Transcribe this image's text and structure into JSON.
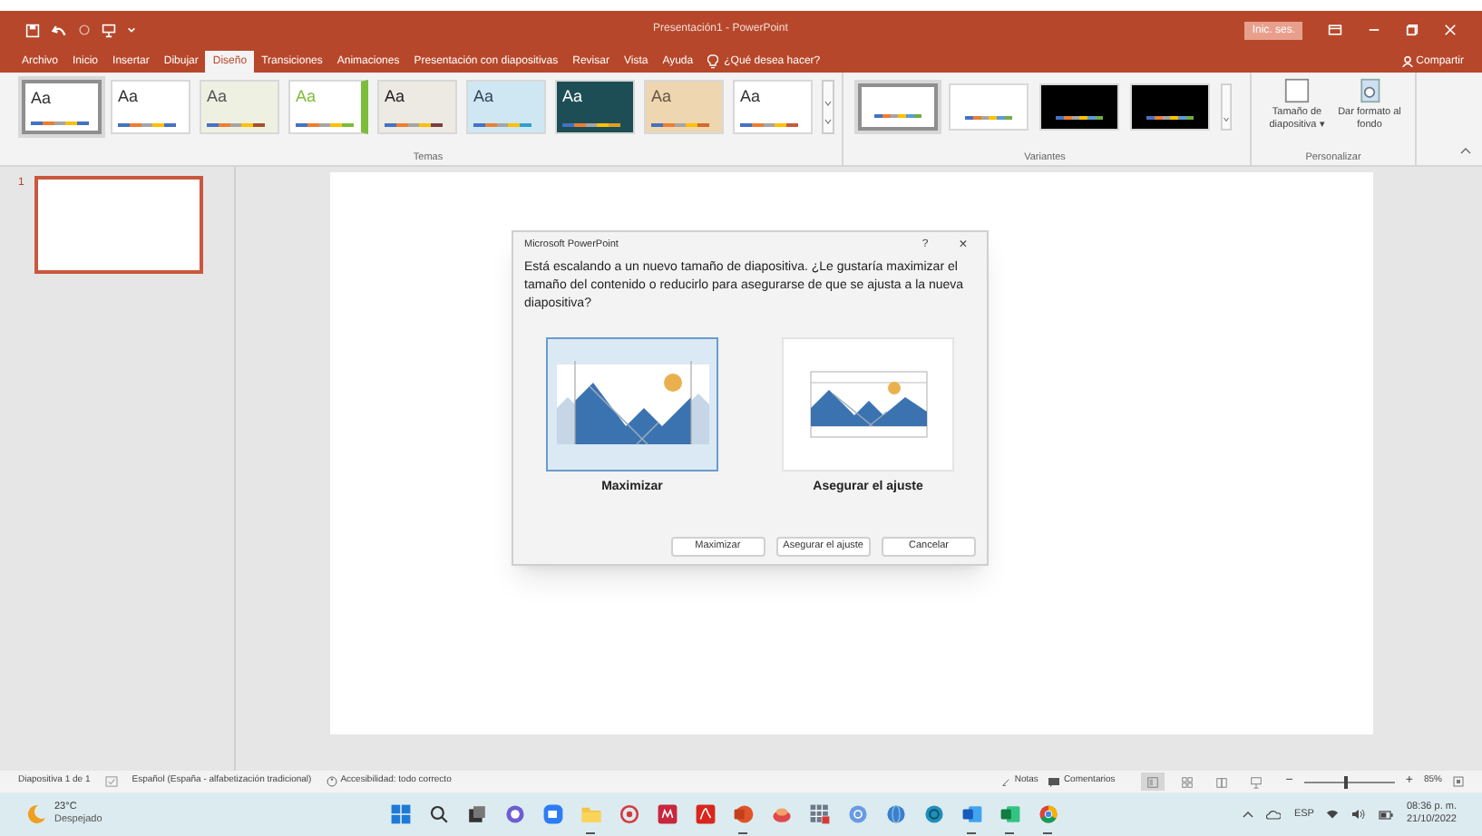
{
  "window": {
    "title": "Presentación1 - PowerPoint",
    "sign_in": "Inic. ses."
  },
  "ribbon_tabs": [
    {
      "label": "Archivo",
      "selected": false
    },
    {
      "label": "Inicio",
      "selected": false
    },
    {
      "label": "Insertar",
      "selected": false
    },
    {
      "label": "Dibujar",
      "selected": false
    },
    {
      "label": "Diseño",
      "selected": true
    },
    {
      "label": "Transiciones",
      "selected": false
    },
    {
      "label": "Animaciones",
      "selected": false
    },
    {
      "label": "Presentación con diapositivas",
      "selected": false
    },
    {
      "label": "Revisar",
      "selected": false
    },
    {
      "label": "Vista",
      "selected": false
    },
    {
      "label": "Ayuda",
      "selected": false
    }
  ],
  "tell_me": "¿Qué desea hacer?",
  "share": "Compartir",
  "themes": {
    "label": "Temas",
    "items": [
      {
        "label": "Aa",
        "selected": true
      },
      {
        "label": "Aa",
        "selected": false
      },
      {
        "label": "Aa",
        "selected": false
      },
      {
        "label": "Aa",
        "selected": false
      },
      {
        "label": "Aa",
        "selected": false
      },
      {
        "label": "Aa",
        "selected": false
      },
      {
        "label": "Aa",
        "selected": false
      },
      {
        "label": "Aa",
        "selected": false
      },
      {
        "label": "Aa",
        "selected": false
      }
    ]
  },
  "variants": {
    "label": "Variantes",
    "items": [
      {
        "selected": true
      },
      {
        "selected": false
      },
      {
        "selected": false
      },
      {
        "selected": false
      }
    ]
  },
  "customize": {
    "label": "Personalizar",
    "buttons": [
      {
        "kind": "size",
        "label": "Tamaño de diapositiva",
        "caret": "▾"
      },
      {
        "kind": "background",
        "label": "Dar formato al fondo"
      }
    ]
  },
  "slides": [
    {
      "number": "1",
      "selected": true
    }
  ],
  "dialog": {
    "title": "Microsoft PowerPoint",
    "help": "?",
    "close": "×",
    "message": "Está escalando a un nuevo tamaño de diapositiva. ¿Le gustaría maximizar el tamaño del contenido o reducirlo para asegurarse de que se ajusta a la nueva diapositiva?",
    "options": [
      {
        "kind": "maximize",
        "label": "Maximizar",
        "selected": true
      },
      {
        "kind": "fit",
        "label": "Asegurar el ajuste",
        "selected": false
      }
    ],
    "buttons": [
      "Maximizar",
      "Asegurar el ajuste",
      "Cancelar"
    ]
  },
  "status_bar": {
    "slide": "Diapositiva 1 de 1",
    "language": "Español (España - alfabetización tradicional)",
    "accessibility": "Accesibilidad: todo correcto",
    "notes": "Notas",
    "comments": "Comentarios",
    "views": [
      {
        "kind": "normal",
        "selected": true
      },
      {
        "kind": "sorter",
        "selected": false
      },
      {
        "kind": "reading",
        "selected": false
      },
      {
        "kind": "show",
        "selected": false
      }
    ],
    "zoom_out": "−",
    "zoom_slider": {
      "level": 0.45
    },
    "zoom_in": "+",
    "zoom": "85%"
  },
  "taskbar": {
    "temperature": "23°C",
    "weather": "Despejado",
    "apps": [
      {
        "kind": "start",
        "running": false
      },
      {
        "kind": "search",
        "running": false
      },
      {
        "kind": "taskview",
        "running": false
      },
      {
        "kind": "chat",
        "running": false
      },
      {
        "kind": "meet",
        "running": false
      },
      {
        "kind": "folder",
        "running": true
      },
      {
        "kind": "target",
        "running": false
      },
      {
        "kind": "redapp",
        "running": false
      },
      {
        "kind": "pdf",
        "running": false
      },
      {
        "kind": "powerpoint",
        "running": true
      },
      {
        "kind": "cake",
        "running": false
      },
      {
        "kind": "grid",
        "running": false
      },
      {
        "kind": "rcircle",
        "running": false
      },
      {
        "kind": "globe",
        "running": false
      },
      {
        "kind": "ring",
        "running": false
      },
      {
        "kind": "word",
        "running": true
      },
      {
        "kind": "excel",
        "running": true
      },
      {
        "kind": "chrome",
        "running": true
      }
    ],
    "language": "ESP",
    "time": "08:36 p. m.",
    "date": "21/10/2022"
  }
}
